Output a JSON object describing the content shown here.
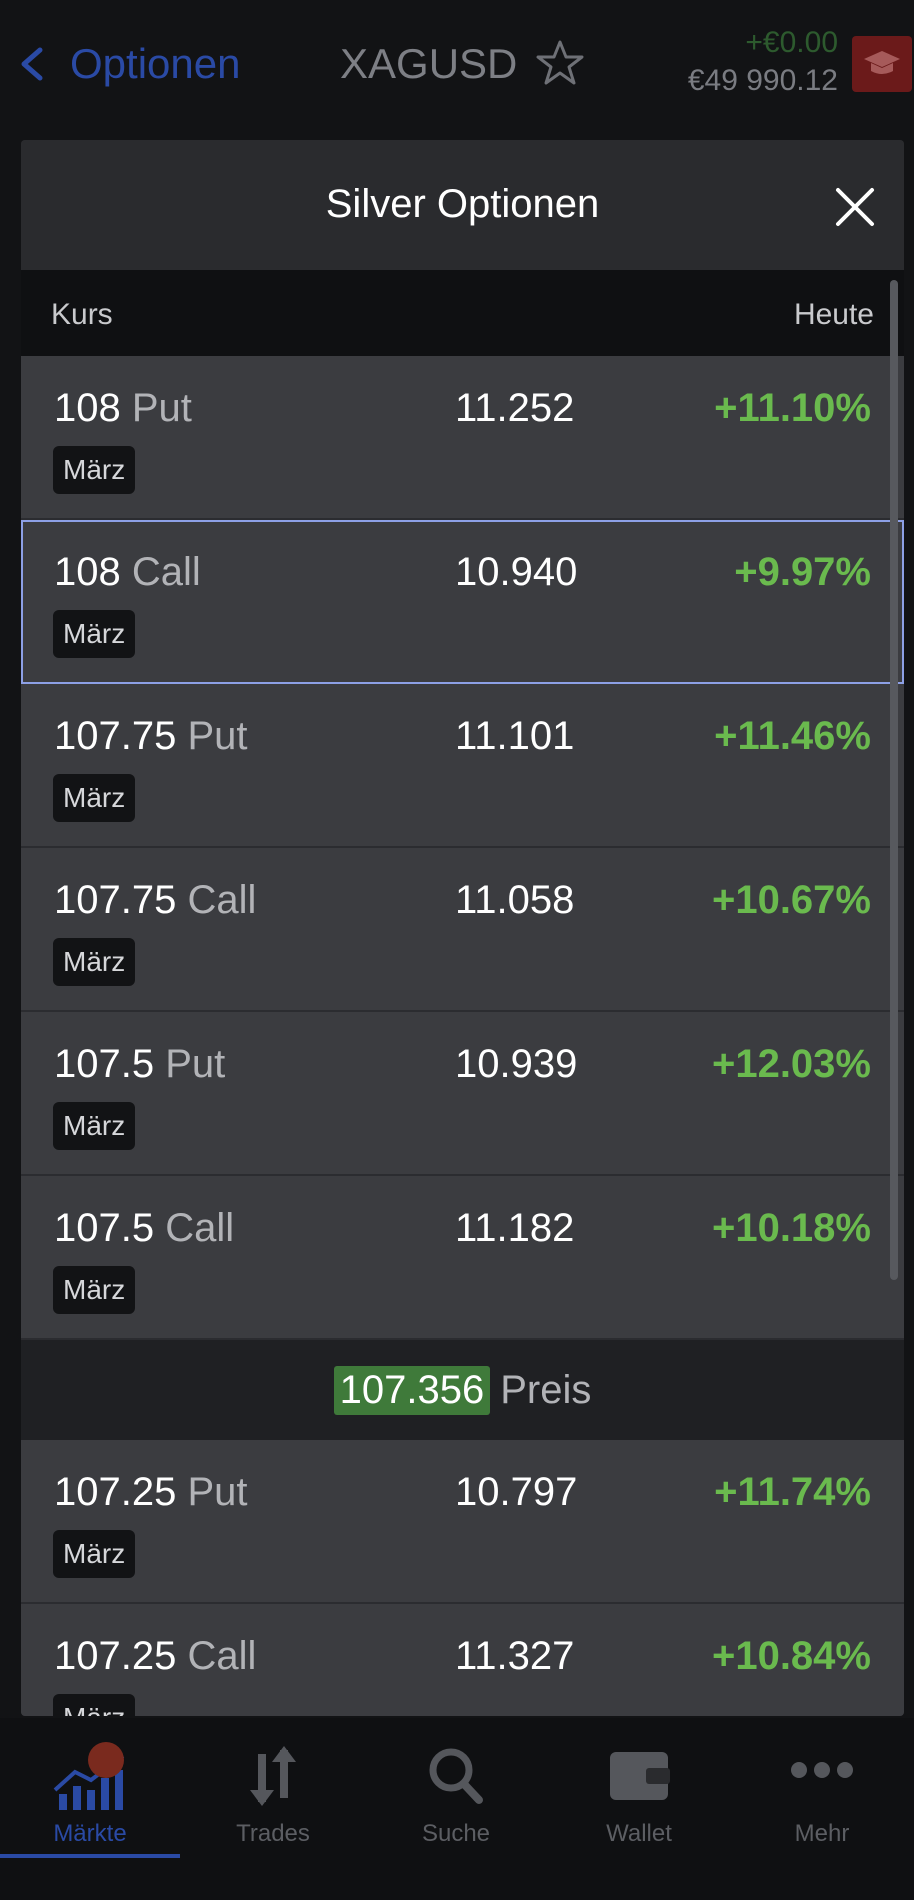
{
  "header": {
    "back_label": "Optionen",
    "symbol": "XAGUSD",
    "pnl": "+€0.00",
    "balance": "€49 990.12"
  },
  "modal": {
    "title": "Silver Optionen",
    "col_kurs": "Kurs",
    "col_heute": "Heute",
    "rows_top": [
      {
        "strike": "108",
        "type": "Put",
        "expiry": "März",
        "price": "11.252",
        "change": "+11.10%"
      },
      {
        "strike": "108",
        "type": "Call",
        "expiry": "März",
        "price": "10.940",
        "change": "+9.97%"
      },
      {
        "strike": "107.75",
        "type": "Put",
        "expiry": "März",
        "price": "11.101",
        "change": "+11.46%"
      },
      {
        "strike": "107.75",
        "type": "Call",
        "expiry": "März",
        "price": "11.058",
        "change": "+10.67%"
      },
      {
        "strike": "107.5",
        "type": "Put",
        "expiry": "März",
        "price": "10.939",
        "change": "+12.03%"
      },
      {
        "strike": "107.5",
        "type": "Call",
        "expiry": "März",
        "price": "11.182",
        "change": "+10.18%"
      }
    ],
    "spot": {
      "price": "107.356",
      "label": "Preis"
    },
    "rows_bottom": [
      {
        "strike": "107.25",
        "type": "Put",
        "expiry": "März",
        "price": "10.797",
        "change": "+11.74%"
      },
      {
        "strike": "107.25",
        "type": "Call",
        "expiry": "März",
        "price": "11.327",
        "change": "+10.84%"
      }
    ]
  },
  "nav": {
    "items": [
      {
        "label": "Märkte",
        "icon": "markets-icon"
      },
      {
        "label": "Trades",
        "icon": "trades-icon"
      },
      {
        "label": "Suche",
        "icon": "search-icon"
      },
      {
        "label": "Wallet",
        "icon": "wallet-icon"
      },
      {
        "label": "Mehr",
        "icon": "more-icon"
      }
    ]
  },
  "colors": {
    "accent": "#2a4aa5",
    "positive": "#6aba4e",
    "spot_bg": "#3f7a3a",
    "selected_outline": "#8da0e6"
  }
}
